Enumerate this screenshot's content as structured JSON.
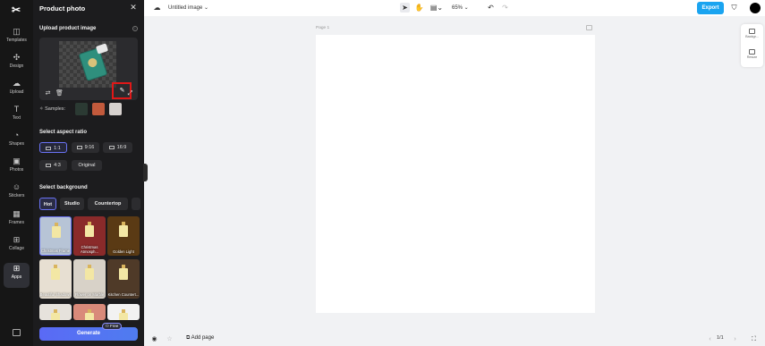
{
  "rail": {
    "items": [
      {
        "label": "Templates",
        "icon": "templates-icon",
        "glyph": "◫"
      },
      {
        "label": "Design",
        "icon": "design-icon",
        "glyph": "✣"
      },
      {
        "label": "Upload",
        "icon": "upload-icon",
        "glyph": "☁"
      },
      {
        "label": "Text",
        "icon": "text-icon",
        "glyph": "T"
      },
      {
        "label": "Shapes",
        "icon": "shapes-icon",
        "glyph": "◔"
      },
      {
        "label": "Photos",
        "icon": "photos-icon",
        "glyph": "▣"
      },
      {
        "label": "Stickers",
        "icon": "stickers-icon",
        "glyph": "☺"
      },
      {
        "label": "Frames",
        "icon": "frames-icon",
        "glyph": "▦"
      },
      {
        "label": "Collage",
        "icon": "collage-icon",
        "glyph": "⊞"
      },
      {
        "label": "Apps",
        "icon": "apps-icon",
        "glyph": "⊞"
      }
    ]
  },
  "panel": {
    "title": "Product photo",
    "upload_title": "Upload product image",
    "samples_label": "Samples:",
    "aspect_title": "Select aspect ratio",
    "ratios": [
      "1:1",
      "9:16",
      "16:9",
      "4:3",
      "Original"
    ],
    "background_title": "Select background",
    "bg_tabs": [
      "Hot",
      "Studio",
      "Countertop"
    ],
    "tiles": [
      {
        "caption": "Christmas Frame",
        "bg": "#b7c4d6"
      },
      {
        "caption": "Christmas Atmosph...",
        "bg": "#8a2a2a"
      },
      {
        "caption": "Golden Light",
        "bg": "#5a3a14"
      },
      {
        "caption": "Beautiful Shadows",
        "bg": "#e7dfd2"
      },
      {
        "caption": "Flower on Marble",
        "bg": "#d8d2c8"
      },
      {
        "caption": "Kitchen Countert...",
        "bg": "#4f3a28"
      },
      {
        "caption": "",
        "bg": "#e6e2dc"
      },
      {
        "caption": "",
        "bg": "#d98a7a"
      },
      {
        "caption": "",
        "bg": "#f2f2f2"
      }
    ],
    "generate_label": "Generate",
    "free_badge": "Free"
  },
  "topbar": {
    "doc_name": "Untitled image",
    "zoom": "65%",
    "export_label": "Export"
  },
  "canvas": {
    "page_label": "Page 1"
  },
  "side_tools": [
    "Backgr...",
    "Resize"
  ],
  "bottombar": {
    "add_page": "Add page",
    "pager": "1/1"
  },
  "colors": {
    "accent": "#1aa4f0",
    "generate": "#5a6af5",
    "highlight": "#e01818"
  }
}
